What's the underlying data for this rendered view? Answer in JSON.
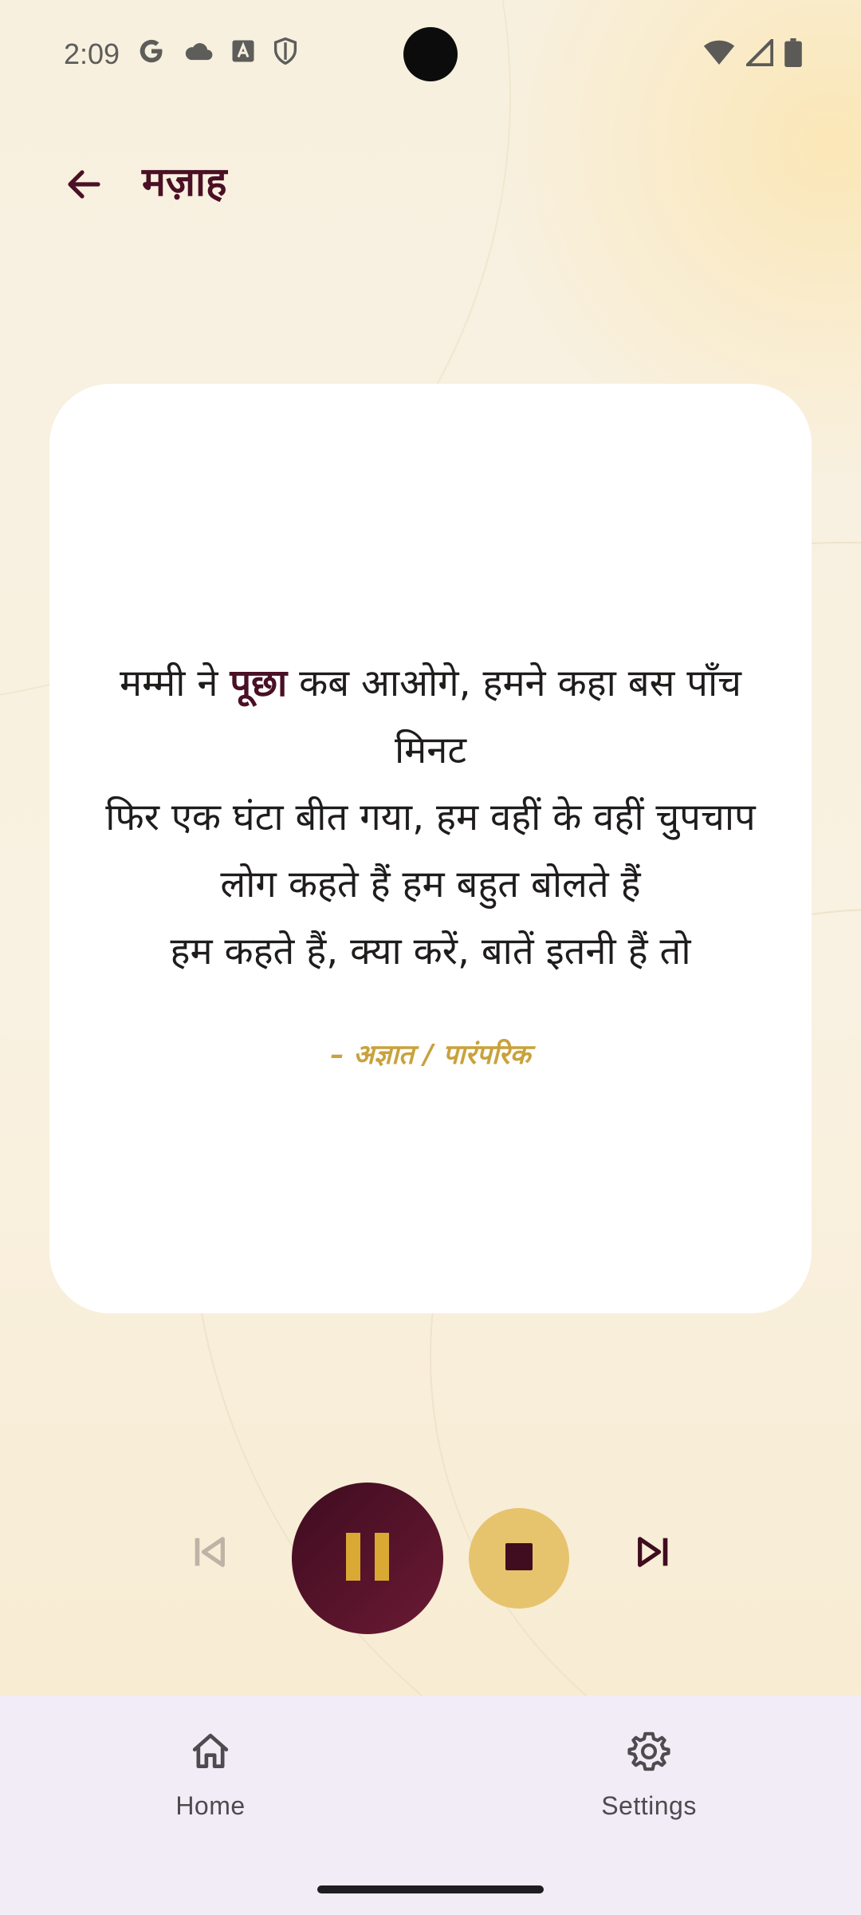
{
  "status_bar": {
    "time": "2:09",
    "left_icons": [
      "google-icon",
      "cloud-icon",
      "font-icon",
      "shield-icon"
    ],
    "right_icons": [
      "wifi-icon",
      "signal-icon",
      "battery-icon"
    ]
  },
  "app_bar": {
    "back_icon": "arrow-back-icon",
    "title": "मज़ाह"
  },
  "quote": {
    "lines": [
      {
        "before": "मम्मी ने ",
        "highlight": "पूछा",
        "after": " कब आओगे, हमने कहा बस पाँच मिनट"
      },
      {
        "text": "फिर एक घंटा बीत गया, हम वहीं के वहीं चुपचाप"
      },
      {
        "text": "लोग कहते हैं हम बहुत बोलते हैं"
      },
      {
        "text": "हम कहते हैं, क्या करें, बातें इतनी हैं तो"
      }
    ],
    "author": "– अज्ञात / पारंपरिक"
  },
  "player": {
    "previous_icon": "skip-previous-icon",
    "pause_icon": "pause-icon",
    "stop_icon": "stop-icon",
    "next_icon": "skip-next-icon",
    "previous_enabled": false
  },
  "bottom_nav": {
    "items": [
      {
        "label": "Home",
        "icon": "home-icon"
      },
      {
        "label": "Settings",
        "icon": "gear-icon"
      }
    ]
  },
  "colors": {
    "background": "#f8f0df",
    "accent_maroon": "#4a1025",
    "accent_gold": "#e6c46d",
    "author_gold": "#c9a23c",
    "card": "#ffffff",
    "nav_background": "#f2ecf6"
  }
}
